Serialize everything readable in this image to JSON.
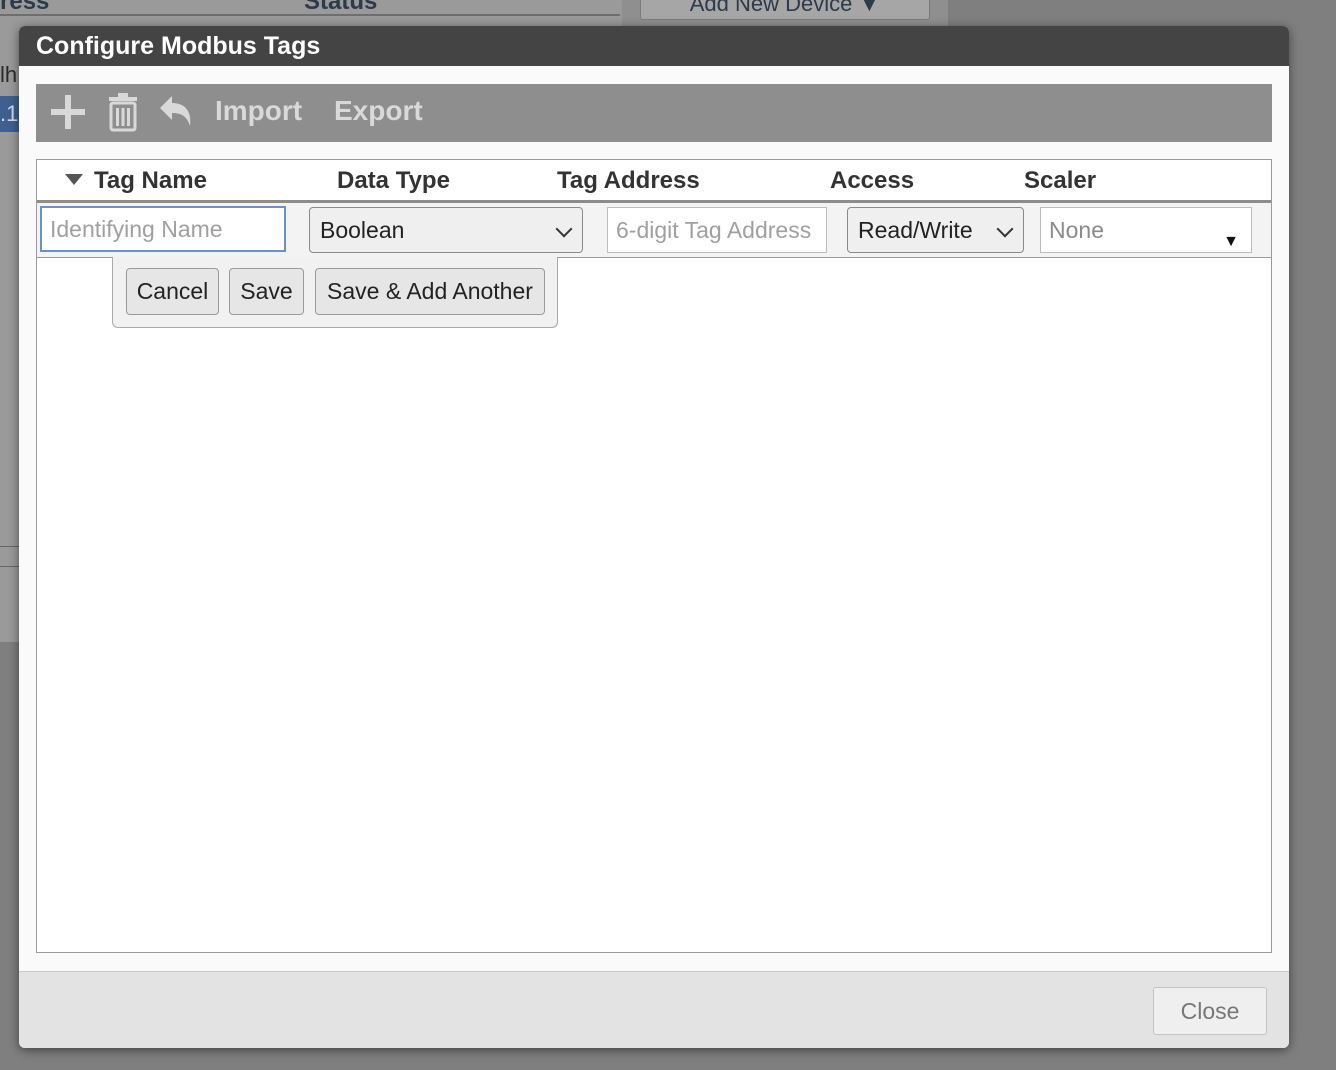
{
  "background": {
    "col_address": "ress",
    "col_status": "Status",
    "add_new_device": "Add New Device ▼",
    "row_text": "lh",
    "row_selected_text": ".1"
  },
  "dialog": {
    "title": "Configure Modbus Tags",
    "toolbar": {
      "add_icon": "plus-icon",
      "delete_icon": "trash-icon",
      "undo_icon": "undo-icon",
      "import_label": "Import",
      "export_label": "Export"
    },
    "columns": [
      "Tag Name",
      "Data Type",
      "Tag Address",
      "Access",
      "Scaler"
    ],
    "edit_row": {
      "tag_name_placeholder": "Identifying Name",
      "data_type": "Boolean",
      "tag_address_placeholder": "6-digit Tag Address",
      "access": "Read/Write",
      "scaler": "None",
      "scaler_arrow": "▼"
    },
    "actions": {
      "cancel": "Cancel",
      "save": "Save",
      "save_add_another": "Save & Add Another"
    },
    "footer": {
      "close": "Close"
    }
  }
}
